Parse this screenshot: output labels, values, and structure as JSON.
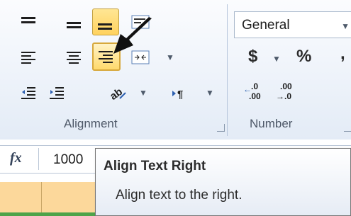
{
  "ribbon": {
    "alignment_group": {
      "label": "Alignment",
      "buttons": [
        "align-top",
        "align-middle",
        "align-bottom",
        "wrap-text",
        "align-left",
        "align-center",
        "align-right",
        "merge-center",
        "decrease-indent",
        "increase-indent",
        "orientation",
        "text-direction"
      ],
      "active": "align-bottom",
      "hover": "align-right"
    },
    "number_group": {
      "label": "Number",
      "format_value": "General",
      "currency_symbol": "$",
      "percent_symbol": "%",
      "comma_symbol": ",",
      "increase_decimal_top": ".0",
      "increase_decimal_bottom": ".00",
      "decrease_decimal_top": ".00",
      "decrease_decimal_bottom": "→.0"
    }
  },
  "formula_bar": {
    "fx_label": "fx",
    "cell_value": "1000"
  },
  "tooltip": {
    "title": "Align Text Right",
    "description": "Align text to the right."
  },
  "colors": {
    "ribbon_bg": "#eef3fa",
    "active_button": "#ffd25e",
    "selected_row": "#fcd89b",
    "accent_green": "#4ea34a"
  }
}
